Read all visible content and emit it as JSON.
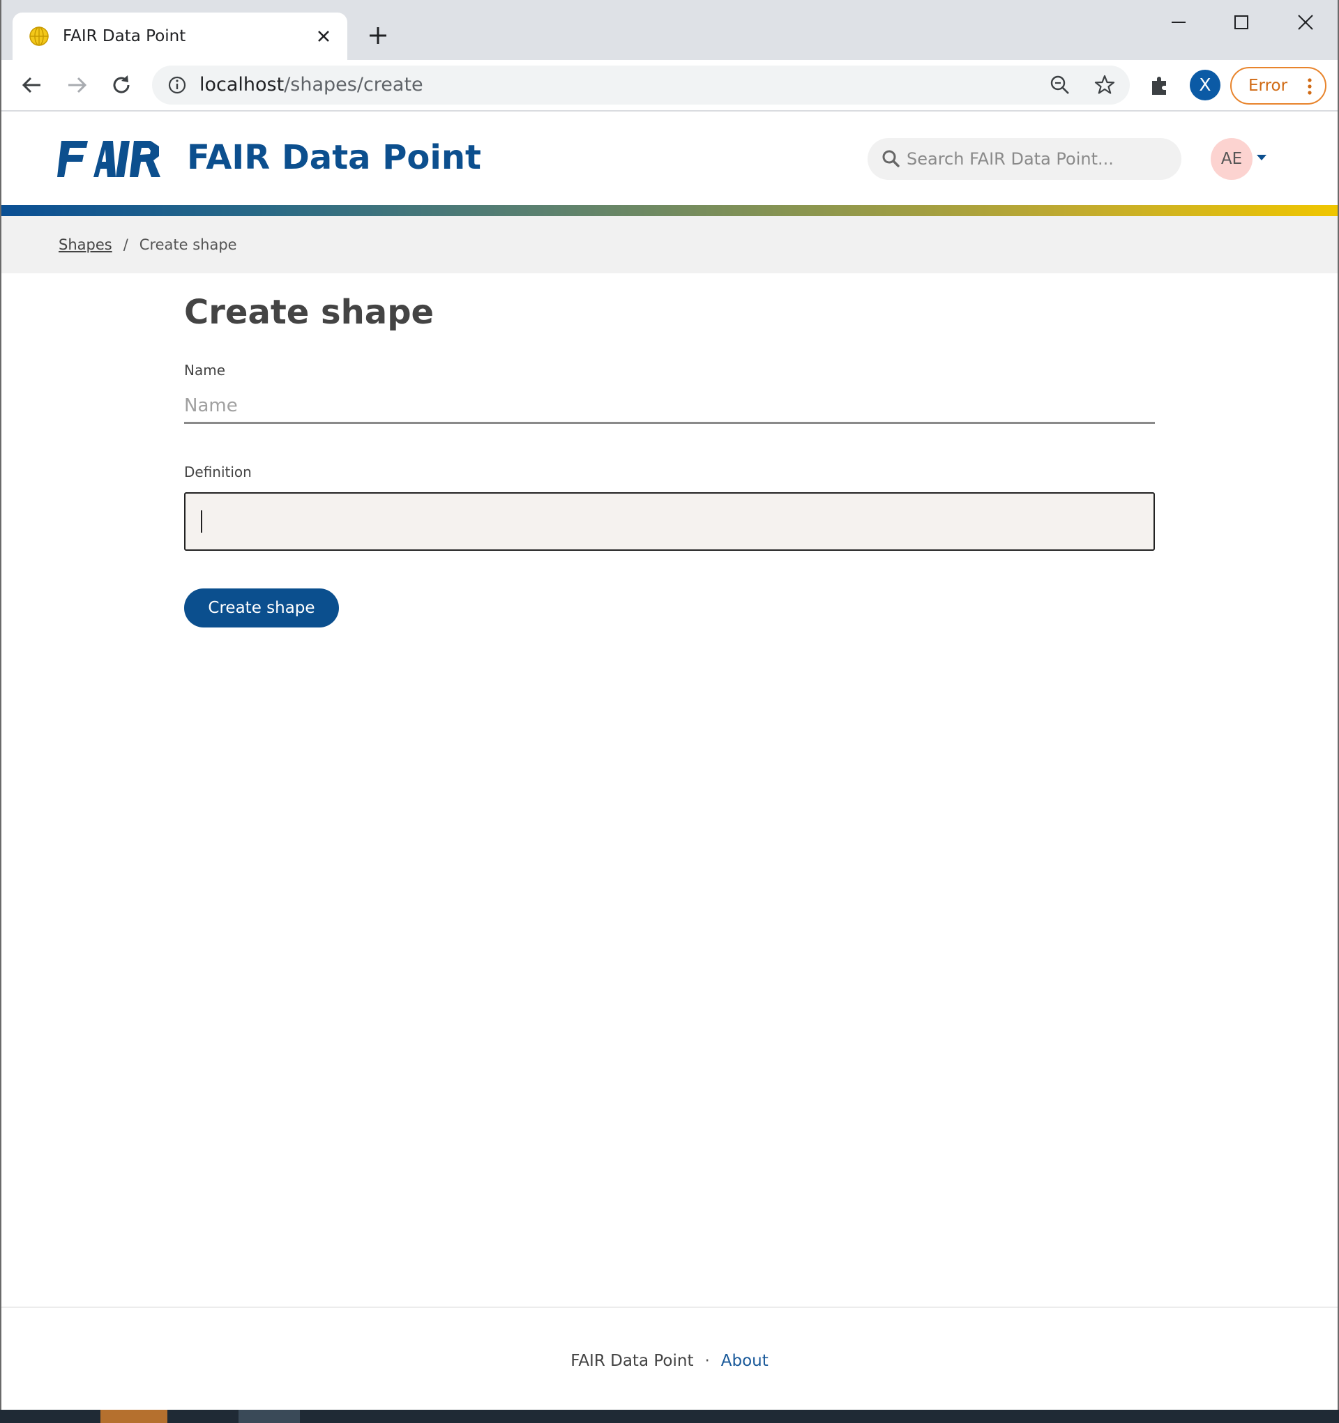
{
  "browser": {
    "tab_title": "FAIR Data Point",
    "tab_close_icon": "close-icon",
    "new_tab_icon": "plus-icon",
    "url_host": "localhost",
    "url_path": "/shapes/create",
    "profile_initial": "X",
    "error_label": "Error"
  },
  "header": {
    "logo_text": "FAIR",
    "site_title": "FAIR Data Point",
    "search_placeholder": "Search FAIR Data Point...",
    "avatar_initials": "AE"
  },
  "breadcrumb": {
    "parent": "Shapes",
    "separator": "/",
    "current": "Create shape"
  },
  "form": {
    "title": "Create shape",
    "name_label": "Name",
    "name_placeholder": "Name",
    "name_value": "",
    "definition_label": "Definition",
    "definition_value": "",
    "submit_label": "Create shape"
  },
  "footer": {
    "name": "FAIR Data Point",
    "separator": "·",
    "about_link": "About"
  },
  "colors": {
    "brand_blue": "#0c4f8e",
    "button_blue": "#0b4f8e",
    "avatar_bg": "#fcd3d0",
    "error_orange": "#e8842c",
    "gradient_start": "#0a4f94",
    "gradient_end": "#f0c600"
  }
}
